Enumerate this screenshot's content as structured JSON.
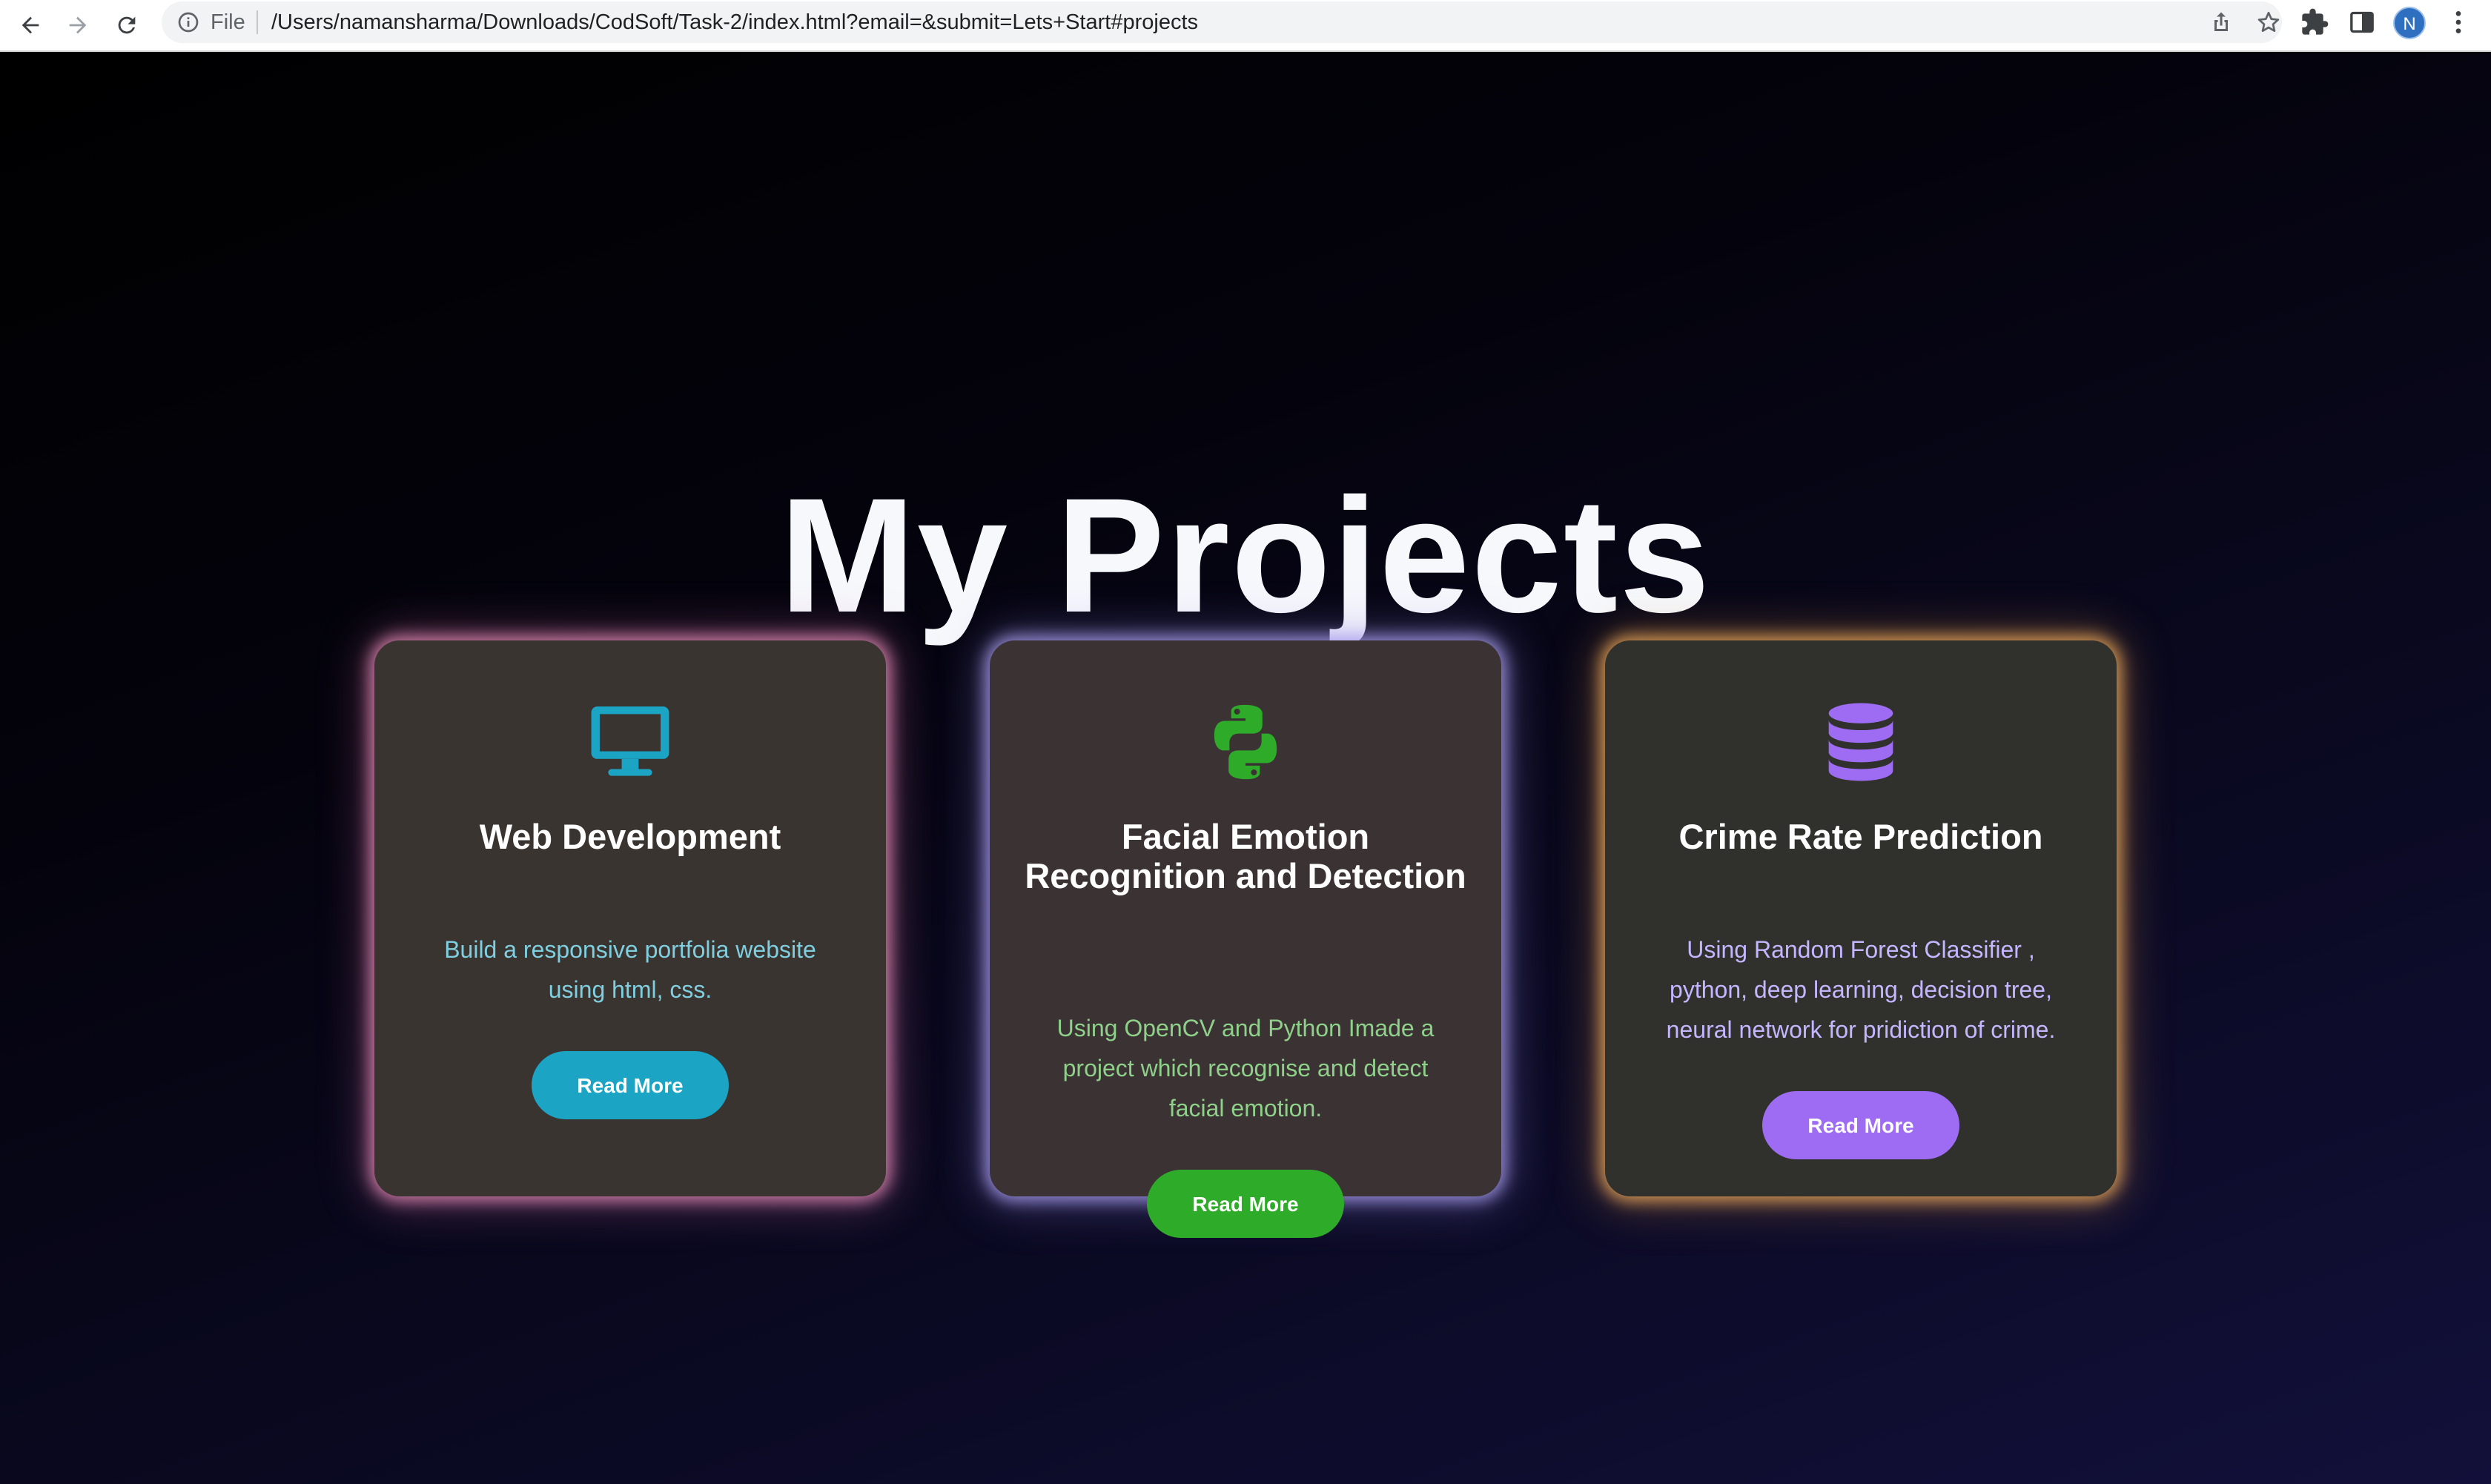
{
  "browser": {
    "scheme_label": "File",
    "url": "/Users/namansharma/Downloads/CodSoft/Task-2/index.html?email=&submit=Lets+Start#projects",
    "profile_initial": "N",
    "icons": [
      "back-arrow-icon",
      "forward-arrow-icon",
      "reload-icon",
      "info-icon",
      "share-icon",
      "star-icon",
      "extensions-puzzle-icon",
      "side-panel-icon",
      "more-vert-icon"
    ]
  },
  "page": {
    "title": "My Projects"
  },
  "projects": [
    {
      "icon": "desktop-monitor-icon",
      "title": "Web Development",
      "description": "Build a responsive portfolia website using html, css.",
      "button_label": "Read More",
      "accent_color": "#1ba4c4",
      "glow_color": "#e88cb8"
    },
    {
      "icon": "python-logo-icon",
      "title": "Facial Emotion Recognition and Detection",
      "description": "Using OpenCV and Python Imade a project which recognise and detect facial emotion.",
      "button_label": "Read More",
      "accent_color": "#2fab2a",
      "glow_color": "#aaa0f0"
    },
    {
      "icon": "database-icon",
      "title": "Crime Rate Prediction",
      "description": "Using Random Forest Classifier , python, deep learning, decision tree, neural network for pridiction of crime.",
      "button_label": "Read More",
      "accent_color": "#9d6cf2",
      "glow_color": "#eeaa5c"
    }
  ]
}
